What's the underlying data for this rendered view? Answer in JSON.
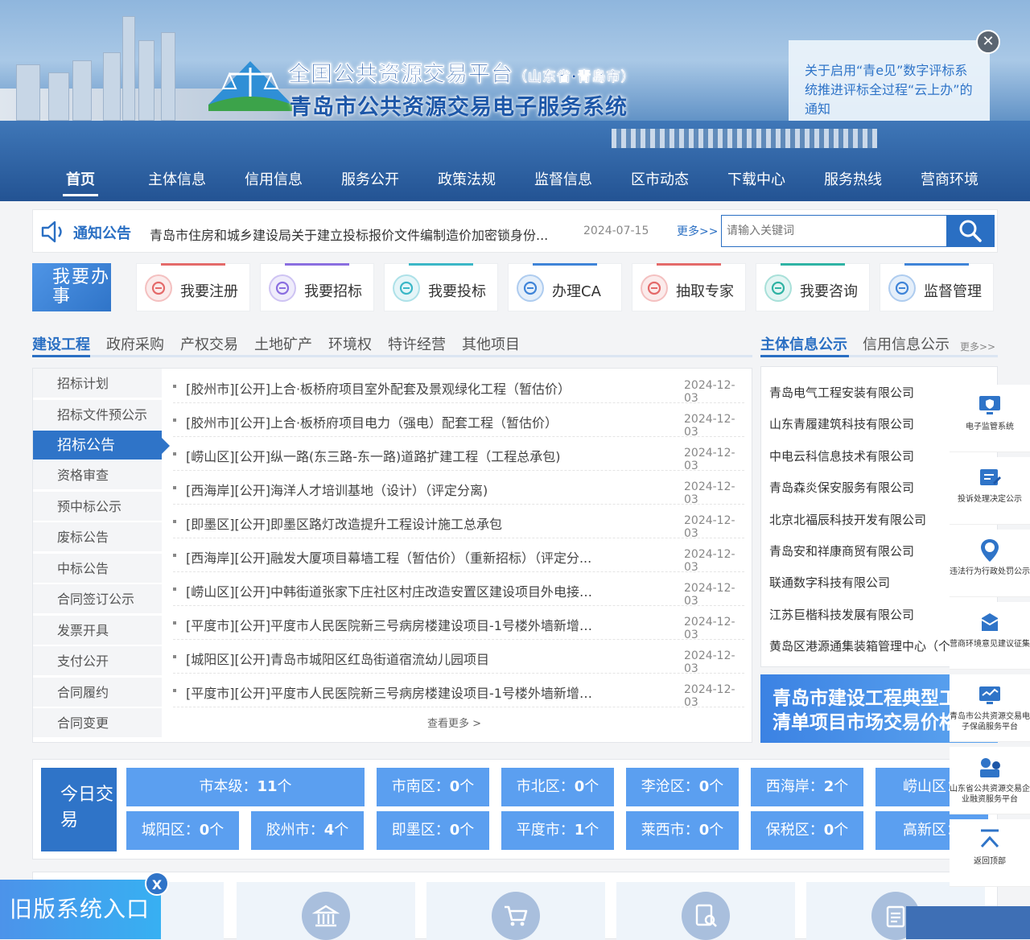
{
  "header": {
    "title_line1": "全国公共资源交易平台",
    "title_line1_sub": "（山东省·青岛市）",
    "title_line2": "青岛市公共资源交易电子服务系统"
  },
  "nav": [
    "首页",
    "主体信息",
    "信用信息",
    "服务公开",
    "政策法规",
    "监督信息",
    "区市动态",
    "下载中心",
    "服务热线",
    "营商环境"
  ],
  "popup": {
    "text": "关于启用“青e见”数字评标系统推进评标全过程“云上办”的通知",
    "close": "✕"
  },
  "notice": {
    "label": "通知公告",
    "text": "青岛市住房和城乡建设局关于建立投标报价文件编制造价加密锁身份...",
    "date": "2024-07-15",
    "more": "更多>>"
  },
  "search": {
    "placeholder": "请输入关键词"
  },
  "todo": {
    "label": "我要办事",
    "items": [
      {
        "label": "我要注册",
        "color": "#e46a6a"
      },
      {
        "label": "我要招标",
        "color": "#8a6ee0"
      },
      {
        "label": "我要投标",
        "color": "#3bb7c7"
      },
      {
        "label": "办理CA",
        "color": "#3f84d8"
      },
      {
        "label": "抽取专家",
        "color": "#e46a6a"
      },
      {
        "label": "我要咨询",
        "color": "#2fb3a4"
      },
      {
        "label": "监督管理",
        "color": "#3f84d8"
      }
    ]
  },
  "project_tabs": [
    "建设工程",
    "政府采购",
    "产权交易",
    "土地矿产",
    "环境权",
    "特许经营",
    "其他项目"
  ],
  "side_items": [
    "招标计划",
    "招标文件预公示",
    "招标公告",
    "资格审查",
    "预中标公示",
    "废标公告",
    "中标公告",
    "合同签订公示",
    "发票开具",
    "支付公开",
    "合同履约",
    "合同变更"
  ],
  "rows": [
    {
      "title": "[胶州市][公开]上合·板桥府项目室外配套及景观绿化工程（暂估价）",
      "date": "2024-12-03"
    },
    {
      "title": "[胶州市][公开]上合·板桥府项目电力（强电）配套工程（暂估价）",
      "date": "2024-12-03"
    },
    {
      "title": "[崂山区][公开]纵一路(东三路-东一路)道路扩建工程（工程总承包)",
      "date": "2024-12-03"
    },
    {
      "title": "[西海岸][公开]海洋人才培训基地（设计）（评定分离)",
      "date": "2024-12-03"
    },
    {
      "title": "[即墨区][公开]即墨区路灯改造提升工程设计施工总承包",
      "date": "2024-12-03"
    },
    {
      "title": "[西海岸][公开]融发大厦项目幕墙工程（暂估价）（重新招标）（评定分...",
      "date": "2024-12-03"
    },
    {
      "title": "[崂山区][公开]中韩街道张家下庄社区村庄改造安置区建设项目外电接入...",
      "date": "2024-12-03"
    },
    {
      "title": "[平度市][公开]平度市人民医院新三号病房楼建设项目-1号楼外墙新增保...",
      "date": "2024-12-03"
    },
    {
      "title": "[城阳区][公开]青岛市城阳区红岛街道宿流幼儿园项目",
      "date": "2024-12-03"
    },
    {
      "title": "[平度市][公开]平度市人民医院新三号病房楼建设项目-1号楼外墙新增保...",
      "date": "2024-12-03"
    }
  ],
  "see_more": "查看更多 >",
  "info_tabs": {
    "tab1": "主体信息公示",
    "tab2": "信用信息公示",
    "more": "更多>>"
  },
  "companies": [
    "青岛电气工程安装有限公司",
    "山东青履建筑科技有限公司",
    "中电云科信息技术有限公司",
    "青岛森炎保安服务有限公司",
    "北京北福辰科技开发有限公司",
    "青岛安和祥康商贸有限公司",
    "联通数字科技有限公司",
    "江苏巨楷科技发展有限公司",
    "黄岛区港源通集装箱管理中心（个"
  ],
  "ad": {
    "line1": "青岛市建设工程典型工",
    "line2": "清单项目市场交易价格"
  },
  "today": {
    "label": "今日交易",
    "row1": [
      {
        "name": "市本级：",
        "count": "11",
        "unit": "个"
      },
      {
        "name": "市南区：",
        "count": "0",
        "unit": "个"
      },
      {
        "name": "市北区：",
        "count": "0",
        "unit": "个"
      },
      {
        "name": "李沧区：",
        "count": "0",
        "unit": "个"
      },
      {
        "name": "西海岸：",
        "count": "2",
        "unit": "个"
      },
      {
        "name": "崂山区：",
        "count": "",
        "unit": ""
      }
    ],
    "row2": [
      {
        "name": "城阳区：",
        "count": "0",
        "unit": "个"
      },
      {
        "name": "胶州市：",
        "count": "4",
        "unit": "个"
      },
      {
        "name": "即墨区：",
        "count": "0",
        "unit": "个"
      },
      {
        "name": "平度市：",
        "count": "1",
        "unit": "个"
      },
      {
        "name": "莱西市：",
        "count": "0",
        "unit": "个"
      },
      {
        "name": "保税区：",
        "count": "0",
        "unit": "个"
      },
      {
        "name": "高新区：",
        "count": "",
        "unit": ""
      }
    ]
  },
  "old_entry": {
    "label": "旧版系统入口",
    "close": "X"
  },
  "float_panel": [
    {
      "label": "电子监管系统",
      "icon": "shield-monitor-icon"
    },
    {
      "label": "投诉处理决定公示",
      "icon": "complaint-icon"
    },
    {
      "label": "违法行为行政处罚公示",
      "icon": "violation-icon"
    },
    {
      "label": "营商环境意见建议征集",
      "icon": "mailbox-icon"
    },
    {
      "label": "青岛市公共资源交易电子保函服务平台",
      "icon": "monitor-chart-icon"
    },
    {
      "label": "山东省公共资源交易企业融资服务平台",
      "icon": "finance-icon"
    },
    {
      "label": "返回顶部",
      "icon": "arrow-up-icon"
    }
  ],
  "colors": {
    "primary": "#2f74c8",
    "accent": "#5b9ff0"
  }
}
